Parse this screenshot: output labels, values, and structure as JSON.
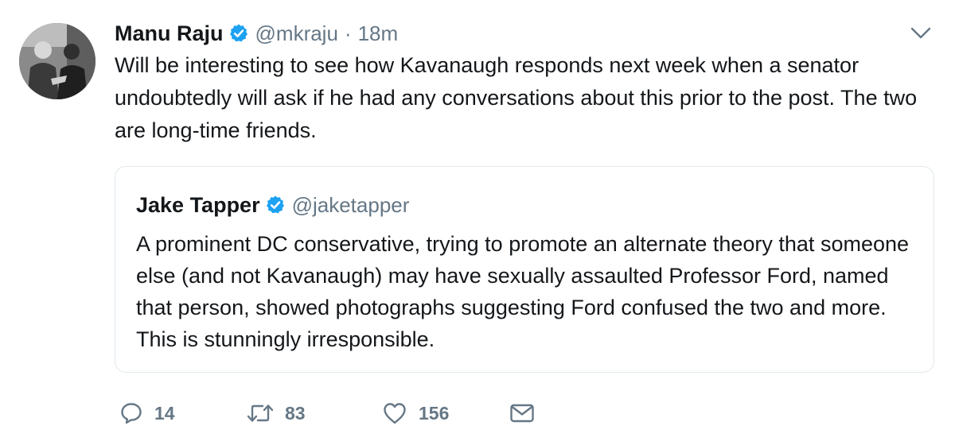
{
  "tweet": {
    "display_name": "Manu Raju",
    "handle": "@mkraju",
    "separator": "·",
    "time": "18m",
    "text": "Will be interesting to see how Kavanaugh responds next week when a senator undoubtedly will ask if he had any conversations about this prior to the post. The two are long-time friends.",
    "verified": true
  },
  "quoted_tweet": {
    "display_name": "Jake Tapper",
    "handle": "@jaketapper",
    "text": "A prominent DC conservative, trying to promote an alternate theory that someone else (and not Kavanaugh) may have sexually assaulted Professor Ford, named that person, showed photographs suggesting Ford confused the two and more. This is stunningly irresponsible.",
    "verified": true
  },
  "actions": {
    "replies": "14",
    "retweets": "83",
    "likes": "156"
  },
  "icons": {
    "verified": "verified-badge-icon",
    "caret": "chevron-down-icon",
    "reply": "reply-bubble-icon",
    "retweet": "retweet-icon",
    "like": "heart-icon",
    "dm": "envelope-icon"
  },
  "colors": {
    "verified_blue": "#1da1f2",
    "secondary_text": "#657786",
    "primary_text": "#14171a",
    "border": "#e1e8ed"
  }
}
